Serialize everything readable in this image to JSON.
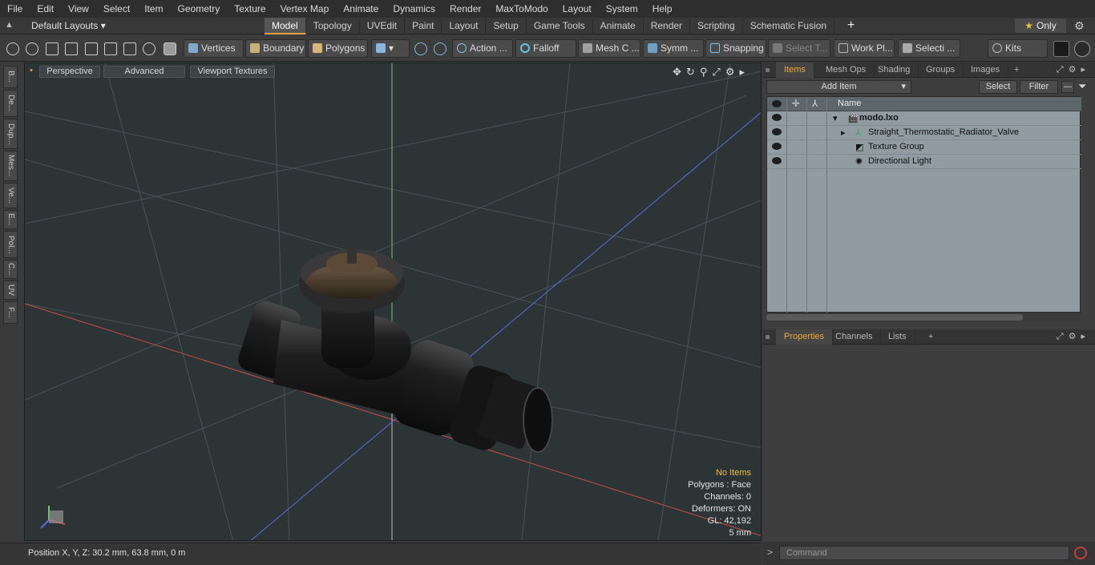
{
  "menu": [
    "File",
    "Edit",
    "View",
    "Select",
    "Item",
    "Geometry",
    "Texture",
    "Vertex Map",
    "Animate",
    "Dynamics",
    "Render",
    "MaxToModo",
    "Layout",
    "System",
    "Help"
  ],
  "layouts_label": "Default Layouts",
  "tabs": [
    "Model",
    "Topology",
    "UVEdit",
    "Paint",
    "Layout",
    "Setup",
    "Game Tools",
    "Animate",
    "Render",
    "Scripting",
    "Schematic Fusion"
  ],
  "only_label": "Only",
  "toolbar": {
    "vertices": "Vertices",
    "boundary": "Boundary",
    "polygons": "Polygons",
    "action": "Action",
    "falloff": "Falloff",
    "mesh": "Mesh C ...",
    "symm": "Symm ...",
    "snapping": "Snapping",
    "select_t": "Select T...",
    "workpl": "Work Pl...",
    "selecti": "Selecti ...",
    "kits": "Kits"
  },
  "left_tabs": [
    "B...",
    "De...",
    "Dup...",
    "Mes...",
    "Ve...",
    "E...",
    "Pol...",
    "C...",
    "UV",
    "F..."
  ],
  "viewport": {
    "perspective": "Perspective",
    "advanced": "Advanced",
    "viewport_textures": "Viewport Textures",
    "stats": {
      "no_items": "No Items",
      "polygons": "Polygons : Face",
      "channels": "Channels: 0",
      "deformers": "Deformers: ON",
      "gl": "GL: 42,192",
      "scale": "5 mm"
    }
  },
  "status": {
    "position": "Position X, Y, Z:   30.2 mm, 63.8 mm, 0 m"
  },
  "items_panel": {
    "tabs": [
      "Items",
      "Mesh Ops",
      "Shading",
      "Groups",
      "Images"
    ],
    "add_item": "Add Item",
    "select": "Select",
    "filter": "Filter",
    "name_col": "Name",
    "rows": [
      {
        "label": "modo.lxo",
        "indent": 0
      },
      {
        "label": "Straight_Thermostatic_Radiator_Valve",
        "indent": 1
      },
      {
        "label": "Texture Group",
        "indent": 1
      },
      {
        "label": "Directional Light",
        "indent": 1
      }
    ]
  },
  "props_panel": {
    "tabs": [
      "Properties",
      "Channels",
      "Lists"
    ]
  },
  "command_placeholder": "Command",
  "colors": {
    "accent": "#e8a33d",
    "active_tab_text": "#f0a830",
    "stats_highlight": "#f0c040"
  }
}
